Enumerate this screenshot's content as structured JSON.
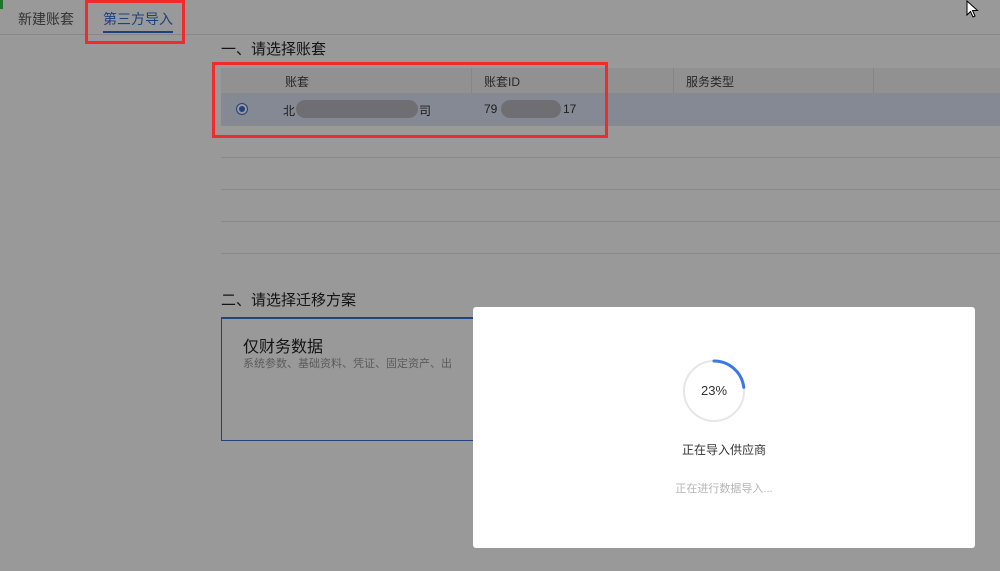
{
  "tabs": [
    {
      "label": "新建账套"
    },
    {
      "label": "第三方导入"
    }
  ],
  "section1": {
    "title": "一、请选择账套"
  },
  "table": {
    "headers": [
      "账套",
      "账套ID",
      "服务类型"
    ],
    "rows": [
      {
        "name_prefix": "北",
        "name_suffix": "司",
        "id_prefix": "79",
        "id_suffix": "17",
        "service": ""
      }
    ]
  },
  "section2": {
    "title": "二、请选择迁移方案"
  },
  "plan": {
    "title": "仅财务数据",
    "desc": "系统参数、基础资料、凭证、固定资产、出"
  },
  "modal": {
    "progress": 23,
    "progress_label": "23%",
    "message": "正在导入供应商",
    "sub_message": "正在进行数据导入...",
    "accent_color": "#3b78e7"
  }
}
